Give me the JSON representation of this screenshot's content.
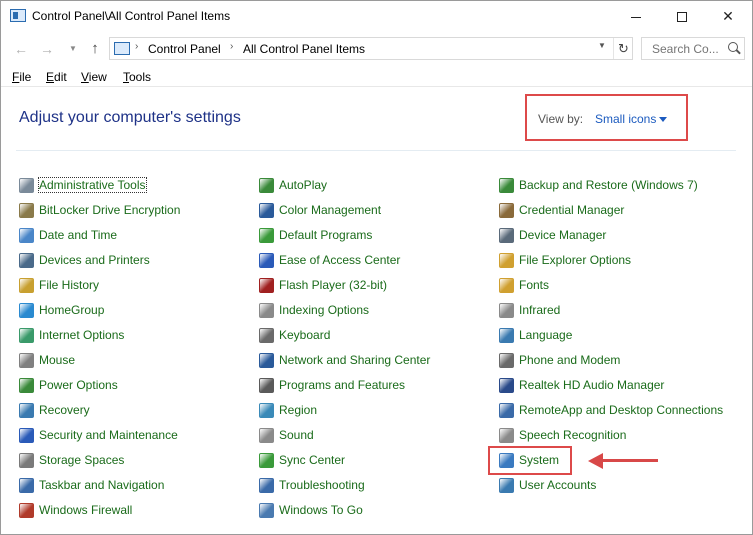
{
  "window": {
    "title": "Control Panel\\All Control Panel Items",
    "minimize": "Minimize",
    "maximize": "Maximize",
    "close": "✕"
  },
  "address": {
    "breadcrumbs": [
      "Control Panel",
      "All Control Panel Items"
    ],
    "separator": "›",
    "search_placeholder": "Search Co..."
  },
  "menu": [
    {
      "first": "F",
      "rest": "ile"
    },
    {
      "first": "E",
      "rest": "dit"
    },
    {
      "first": "V",
      "rest": "iew"
    },
    {
      "first": "T",
      "rest": "ools"
    }
  ],
  "heading": "Adjust your computer's settings",
  "view_by": {
    "label": "View by:",
    "value": "Small icons"
  },
  "columns": [
    {
      "items": [
        {
          "label": "Administrative Tools",
          "color": "#7a8a99"
        },
        {
          "label": "BitLocker Drive Encryption",
          "color": "#8a7a4a"
        },
        {
          "label": "Date and Time",
          "color": "#4a86c8"
        },
        {
          "label": "Devices and Printers",
          "color": "#4a6a8a"
        },
        {
          "label": "File History",
          "color": "#c8a030"
        },
        {
          "label": "HomeGroup",
          "color": "#2a8ad0"
        },
        {
          "label": "Internet Options",
          "color": "#3a9a6a"
        },
        {
          "label": "Mouse",
          "color": "#808080"
        },
        {
          "label": "Power Options",
          "color": "#3a8a3a"
        },
        {
          "label": "Recovery",
          "color": "#3a7ab0"
        },
        {
          "label": "Security and Maintenance",
          "color": "#2a5ab8"
        },
        {
          "label": "Storage Spaces",
          "color": "#7a7a7a"
        },
        {
          "label": "Taskbar and Navigation",
          "color": "#3a6aa8"
        },
        {
          "label": "Windows Firewall",
          "color": "#b03a2a"
        }
      ]
    },
    {
      "items": [
        {
          "label": "AutoPlay",
          "color": "#3a8a3a"
        },
        {
          "label": "Color Management",
          "color": "#2a5a9a"
        },
        {
          "label": "Default Programs",
          "color": "#3a9a3a"
        },
        {
          "label": "Ease of Access Center",
          "color": "#2a5ab8"
        },
        {
          "label": "Flash Player (32-bit)",
          "color": "#a02020"
        },
        {
          "label": "Indexing Options",
          "color": "#8a8a8a"
        },
        {
          "label": "Keyboard",
          "color": "#6a6a6a"
        },
        {
          "label": "Network and Sharing Center",
          "color": "#2a5a9a"
        },
        {
          "label": "Programs and Features",
          "color": "#5a5a5a"
        },
        {
          "label": "Region",
          "color": "#3a8ab8"
        },
        {
          "label": "Sound",
          "color": "#8a8a8a"
        },
        {
          "label": "Sync Center",
          "color": "#3a9a3a"
        },
        {
          "label": "Troubleshooting",
          "color": "#3a6aa8"
        },
        {
          "label": "Windows To Go",
          "color": "#4a7ab0"
        }
      ]
    },
    {
      "items": [
        {
          "label": "Backup and Restore (Windows 7)",
          "color": "#3a8a3a"
        },
        {
          "label": "Credential Manager",
          "color": "#8a6a3a"
        },
        {
          "label": "Device Manager",
          "color": "#5a6a7a"
        },
        {
          "label": "File Explorer Options",
          "color": "#d0a030"
        },
        {
          "label": "Fonts",
          "color": "#d0a030"
        },
        {
          "label": "Infrared",
          "color": "#8a8a8a"
        },
        {
          "label": "Language",
          "color": "#3a7ab0"
        },
        {
          "label": "Phone and Modem",
          "color": "#6a6a6a"
        },
        {
          "label": "Realtek HD Audio Manager",
          "color": "#2a4a8a"
        },
        {
          "label": "RemoteApp and Desktop Connections",
          "color": "#3a6aa8"
        },
        {
          "label": "Speech Recognition",
          "color": "#8a8a8a"
        },
        {
          "label": "System",
          "color": "#3a7ac0"
        },
        {
          "label": "User Accounts",
          "color": "#3a7ab0"
        }
      ]
    }
  ]
}
